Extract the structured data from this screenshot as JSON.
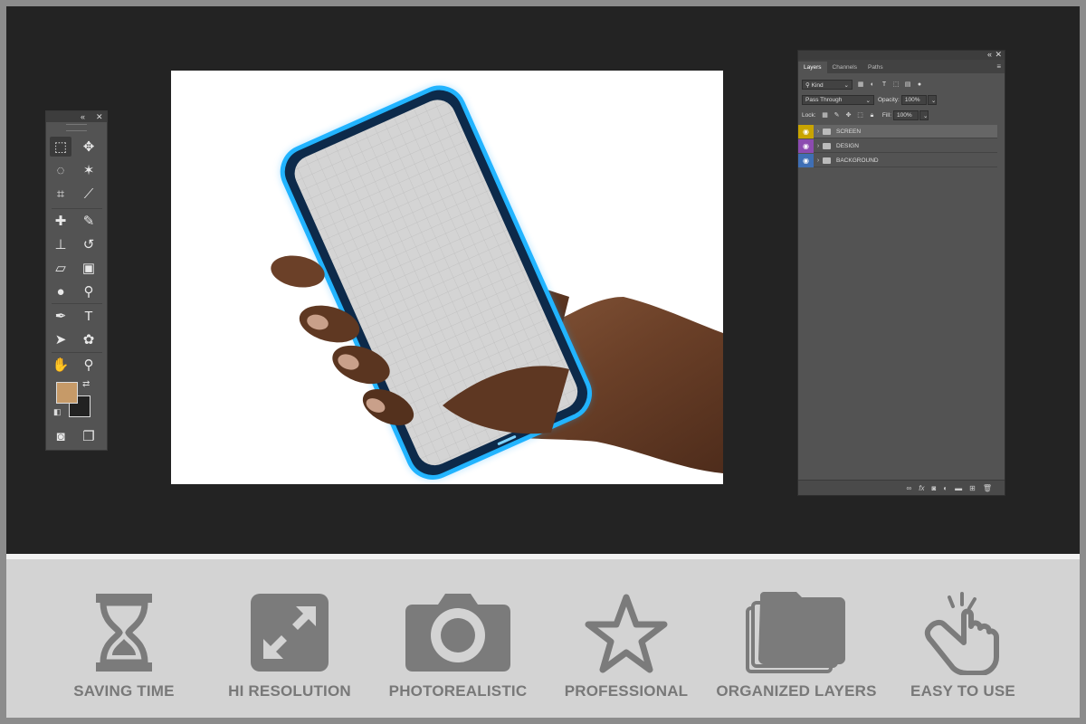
{
  "toolbox": {
    "collapse_glyph": "«",
    "close_glyph": "✕",
    "foreground_color": "#c69a68",
    "background_color": "#222222",
    "tools": [
      {
        "name": "rectangular-marquee-tool",
        "glyph": "⬚"
      },
      {
        "name": "move-tool",
        "glyph": "✥"
      },
      {
        "name": "lasso-tool",
        "glyph": "◌"
      },
      {
        "name": "magic-wand-tool",
        "glyph": "✶"
      },
      {
        "name": "crop-tool",
        "glyph": "⌗"
      },
      {
        "name": "eyedropper-tool",
        "glyph": "⟋"
      },
      {
        "name": "healing-brush-tool",
        "glyph": "✚"
      },
      {
        "name": "brush-tool",
        "glyph": "✎"
      },
      {
        "name": "clone-stamp-tool",
        "glyph": "⊥"
      },
      {
        "name": "history-brush-tool",
        "glyph": "↺"
      },
      {
        "name": "eraser-tool",
        "glyph": "▱"
      },
      {
        "name": "gradient-tool",
        "glyph": "▣"
      },
      {
        "name": "blur-tool",
        "glyph": "●"
      },
      {
        "name": "dodge-tool",
        "glyph": "⚲"
      },
      {
        "name": "pen-tool",
        "glyph": "✒"
      },
      {
        "name": "type-tool",
        "glyph": "T"
      },
      {
        "name": "path-selection-tool",
        "glyph": "➤"
      },
      {
        "name": "custom-shape-tool",
        "glyph": "✿"
      },
      {
        "name": "hand-tool",
        "glyph": "✋"
      },
      {
        "name": "zoom-tool",
        "glyph": "⚲"
      },
      {
        "name": "quick-mask-tool",
        "glyph": "◙"
      },
      {
        "name": "screen-mode-tool",
        "glyph": "❐"
      }
    ]
  },
  "layers_panel": {
    "collapse_glyph": "«",
    "close_glyph": "✕",
    "menu_glyph": "≡",
    "tabs": [
      "Layers",
      "Channels",
      "Paths"
    ],
    "filter_kind": "Kind",
    "blend_mode": "Pass Through",
    "opacity_label": "Opacity:",
    "opacity_value": "100%",
    "lock_label": "Lock:",
    "fill_label": "Fill:",
    "fill_value": "100%",
    "layers": [
      {
        "name": "SCREEN",
        "color": "#c9a400"
      },
      {
        "name": "DESIGN",
        "color": "#8c4bb0"
      },
      {
        "name": "BACKGROUND",
        "color": "#3f6fb5"
      }
    ]
  },
  "features": [
    {
      "label": "SAVING TIME",
      "icon": "hourglass-icon"
    },
    {
      "label": "HI RESOLUTION",
      "icon": "expand-icon"
    },
    {
      "label": "PHOTOREALISTIC",
      "icon": "camera-icon"
    },
    {
      "label": "PROFESSIONAL",
      "icon": "star-icon"
    },
    {
      "label": "ORGANIZED LAYERS",
      "icon": "folders-icon"
    },
    {
      "label": "EASY TO USE",
      "icon": "hand-pointer-icon"
    }
  ],
  "colors": {
    "workspace": "#232323",
    "panel": "#535353",
    "icon_gray": "#7b7b7b",
    "phone_glow": "#1aa8ff"
  }
}
